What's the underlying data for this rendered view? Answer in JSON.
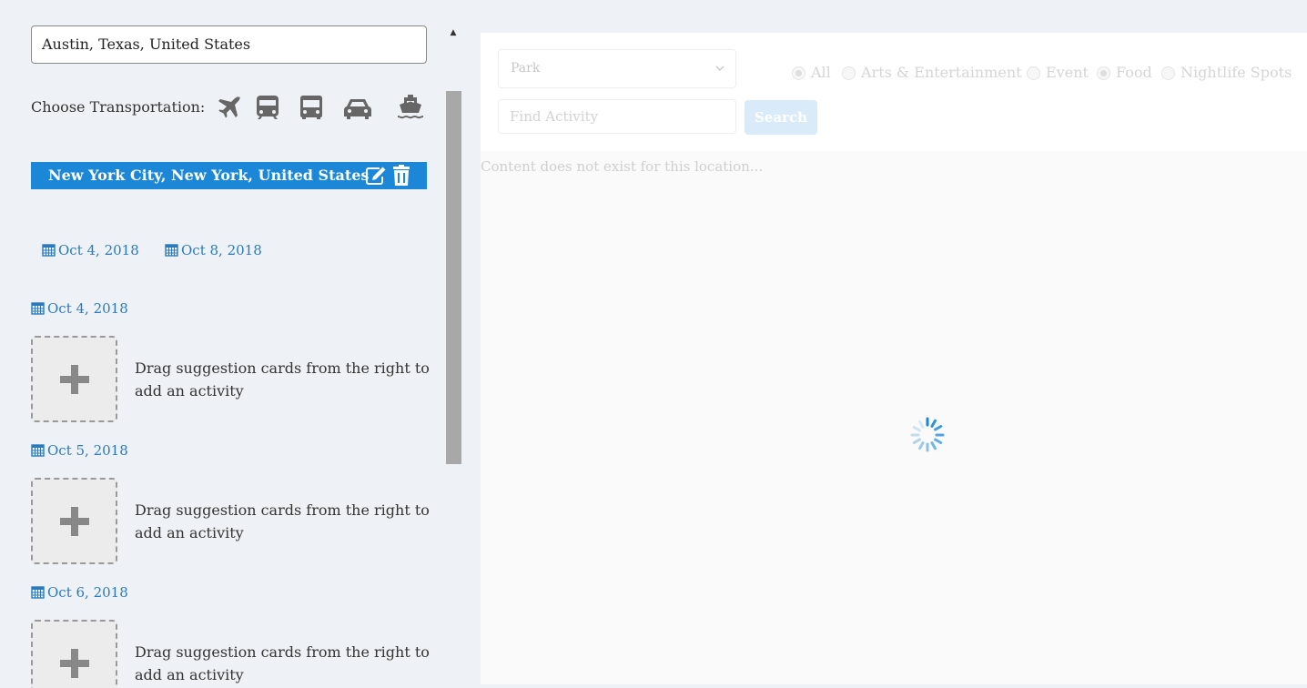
{
  "origin": {
    "value": "Austin, Texas, United States"
  },
  "transportation": {
    "label": "Choose Transportation:",
    "options": [
      "plane-icon",
      "train-icon",
      "bus-icon",
      "car-icon",
      "ship-icon"
    ]
  },
  "destination": {
    "name": "New York City, New York, United States"
  },
  "range": {
    "start": "Oct 4, 2018",
    "end": "Oct 8, 2018"
  },
  "days": [
    {
      "date": "Oct 4, 2018",
      "placeholder": "Drag suggestion cards from the right to add an activity"
    },
    {
      "date": "Oct 5, 2018",
      "placeholder": "Drag suggestion cards from the right to add an activity"
    },
    {
      "date": "Oct 6, 2018",
      "placeholder": "Drag suggestion cards from the right to add an activity"
    }
  ],
  "filters": {
    "category_selected": "Park",
    "find_placeholder": "Find Activity",
    "search_label": "Search",
    "types": [
      {
        "label": "All",
        "checked": true
      },
      {
        "label": "Arts & Entertainment",
        "checked": false
      },
      {
        "label": "Event",
        "checked": false
      },
      {
        "label": "Food",
        "checked": true
      },
      {
        "label": "Nightlife Spots",
        "checked": false
      }
    ]
  },
  "results": {
    "empty_message": "Content does not exist for this location..."
  },
  "colors": {
    "accent": "#1b87d6",
    "link": "#2a7bbd",
    "background": "#eef1f5"
  }
}
